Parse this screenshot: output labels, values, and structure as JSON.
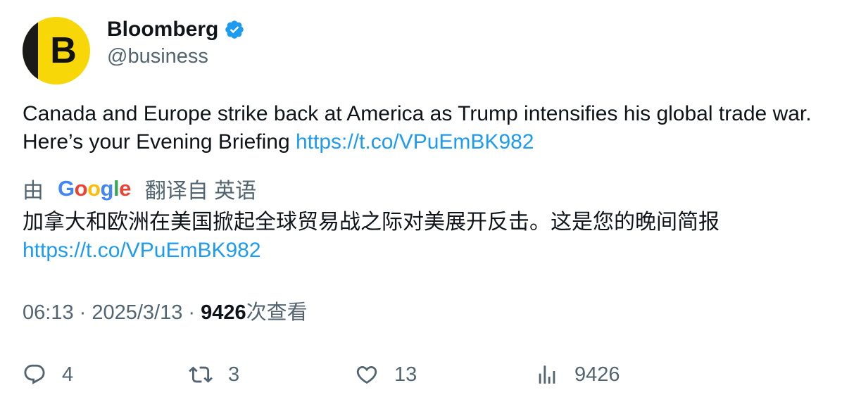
{
  "author": {
    "display_name": "Bloomberg",
    "handle": "@business",
    "avatar_letter": "B",
    "verified": true
  },
  "tweet": {
    "text": "Canada and Europe strike back at America as Trump intensifies his global trade war. Here’s your Evening Briefing ",
    "link": "https://t.co/VPuEmBK982"
  },
  "translation": {
    "prefix": "由",
    "provider": [
      "G",
      "o",
      "o",
      "g",
      "l",
      "e"
    ],
    "suffix": "翻译自 英语",
    "text": "加拿大和欧洲在美国掀起全球贸易战之际对美展开反击。这是您的晚间简报",
    "link": "https://t.co/VPuEmBK982"
  },
  "meta": {
    "time": "06:13",
    "separator": " · ",
    "date": "2025/3/13",
    "views": "9426",
    "views_label": "次查看"
  },
  "actions": {
    "replies": "4",
    "retweets": "3",
    "likes": "13",
    "views": "9426"
  },
  "colors": {
    "link": "#1d9bf0",
    "verified": "#1d9bf0",
    "avatar_bg": "#f7d708",
    "secondary_text": "#536471"
  }
}
